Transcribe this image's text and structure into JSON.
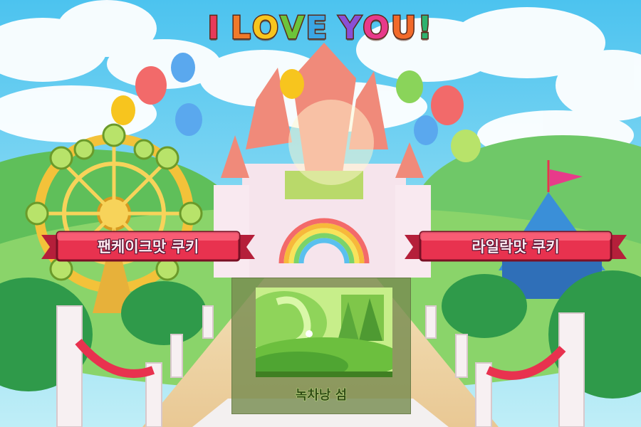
{
  "title": {
    "text": "I LOVE YOU!",
    "letter_colors": [
      "#e83a5a",
      "#f07a2a",
      "#f7c51e",
      "#6cc43a",
      "#3aa6e6",
      "#8a4fd6",
      "#e83a8a",
      "#f26a2a",
      "#2fb26f",
      "#e83a5a",
      "#f7c51e"
    ]
  },
  "banners": {
    "left": {
      "label": "팬케이크맛 쿠키"
    },
    "right": {
      "label": "라일락맛 쿠키"
    }
  },
  "stage": {
    "label": "녹차낭 섬"
  },
  "colors": {
    "sky": "#6fd0f0",
    "banner_red": "#e8324f",
    "card": "#7a8c50",
    "grass": "#7fcf5a"
  }
}
